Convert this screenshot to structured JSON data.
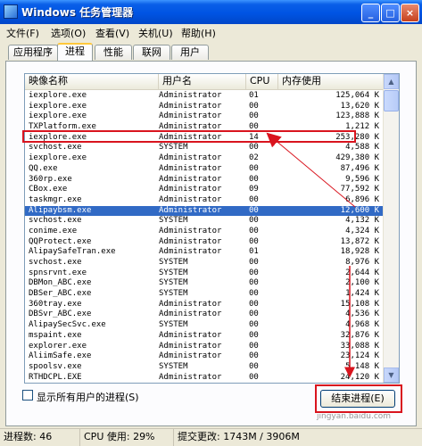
{
  "window": {
    "title": "Windows 任务管理器",
    "minimize_glyph": "_",
    "maximize_glyph": "□",
    "close_glyph": "×"
  },
  "menu": [
    "文件(F)",
    "选项(O)",
    "查看(V)",
    "关机(U)",
    "帮助(H)"
  ],
  "tabs": [
    {
      "label": "应用程序",
      "active": false
    },
    {
      "label": "进程",
      "active": true
    },
    {
      "label": "性能",
      "active": false
    },
    {
      "label": "联网",
      "active": false
    },
    {
      "label": "用户",
      "active": false
    }
  ],
  "columns": [
    "映像名称",
    "用户名",
    "CPU",
    "内存使用"
  ],
  "processes": [
    {
      "image": "iexplore.exe",
      "user": "Administrator",
      "cpu": "01",
      "mem": "125,064 K"
    },
    {
      "image": "iexplore.exe",
      "user": "Administrator",
      "cpu": "00",
      "mem": "13,620 K"
    },
    {
      "image": "iexplore.exe",
      "user": "Administrator",
      "cpu": "00",
      "mem": "123,888 K"
    },
    {
      "image": "TXPlatform.exe",
      "user": "Administrator",
      "cpu": "00",
      "mem": "1,212 K"
    },
    {
      "image": "iexplore.exe",
      "user": "Administrator",
      "cpu": "14",
      "mem": "253,280 K"
    },
    {
      "image": "svchost.exe",
      "user": "SYSTEM",
      "cpu": "00",
      "mem": "4,588 K"
    },
    {
      "image": "iexplore.exe",
      "user": "Administrator",
      "cpu": "02",
      "mem": "429,380 K"
    },
    {
      "image": "QQ.exe",
      "user": "Administrator",
      "cpu": "00",
      "mem": "87,496 K"
    },
    {
      "image": "360rp.exe",
      "user": "Administrator",
      "cpu": "00",
      "mem": "9,596 K"
    },
    {
      "image": "CBox.exe",
      "user": "Administrator",
      "cpu": "09",
      "mem": "77,592 K"
    },
    {
      "image": "taskmgr.exe",
      "user": "Administrator",
      "cpu": "00",
      "mem": "6,896 K"
    },
    {
      "image": "Alipaybsm.exe",
      "user": "Administrator",
      "cpu": "00",
      "mem": "12,600 K",
      "selected": true
    },
    {
      "image": "svchost.exe",
      "user": "SYSTEM",
      "cpu": "00",
      "mem": "4,132 K"
    },
    {
      "image": "conime.exe",
      "user": "Administrator",
      "cpu": "00",
      "mem": "4,324 K"
    },
    {
      "image": "QQProtect.exe",
      "user": "Administrator",
      "cpu": "00",
      "mem": "13,872 K"
    },
    {
      "image": "AlipaySafeTran.exe",
      "user": "Administrator",
      "cpu": "01",
      "mem": "18,928 K"
    },
    {
      "image": "svchost.exe",
      "user": "SYSTEM",
      "cpu": "00",
      "mem": "8,976 K"
    },
    {
      "image": "spnsrvnt.exe",
      "user": "SYSTEM",
      "cpu": "00",
      "mem": "2,644 K"
    },
    {
      "image": "DBMon_ABC.exe",
      "user": "SYSTEM",
      "cpu": "00",
      "mem": "2,100 K"
    },
    {
      "image": "DBSer_ABC.exe",
      "user": "SYSTEM",
      "cpu": "00",
      "mem": "1,424 K"
    },
    {
      "image": "360tray.exe",
      "user": "Administrator",
      "cpu": "00",
      "mem": "15,108 K"
    },
    {
      "image": "DBSvr_ABC.exe",
      "user": "Administrator",
      "cpu": "00",
      "mem": "4,536 K"
    },
    {
      "image": "AlipaySecSvc.exe",
      "user": "SYSTEM",
      "cpu": "00",
      "mem": "4,968 K"
    },
    {
      "image": "mspaint.exe",
      "user": "Administrator",
      "cpu": "00",
      "mem": "32,876 K"
    },
    {
      "image": "explorer.exe",
      "user": "Administrator",
      "cpu": "00",
      "mem": "33,088 K"
    },
    {
      "image": "AliimSafe.exe",
      "user": "Administrator",
      "cpu": "00",
      "mem": "23,124 K"
    },
    {
      "image": "spoolsv.exe",
      "user": "SYSTEM",
      "cpu": "00",
      "mem": "5,148 K"
    },
    {
      "image": "RTHDCPL.EXE",
      "user": "Administrator",
      "cpu": "00",
      "mem": "24,120 K"
    }
  ],
  "show_all_users_label": "显示所有用户的进程(S)",
  "end_process_label": "结束进程(E)",
  "status": {
    "processes": "进程数: 46",
    "cpu": "CPU 使用: 29%",
    "commit": "提交更改: 1743M / 3906M"
  },
  "watermark": "jingyan.baidu.com",
  "colors": {
    "annotation": "#d9141e",
    "selection": "#316ac5"
  }
}
